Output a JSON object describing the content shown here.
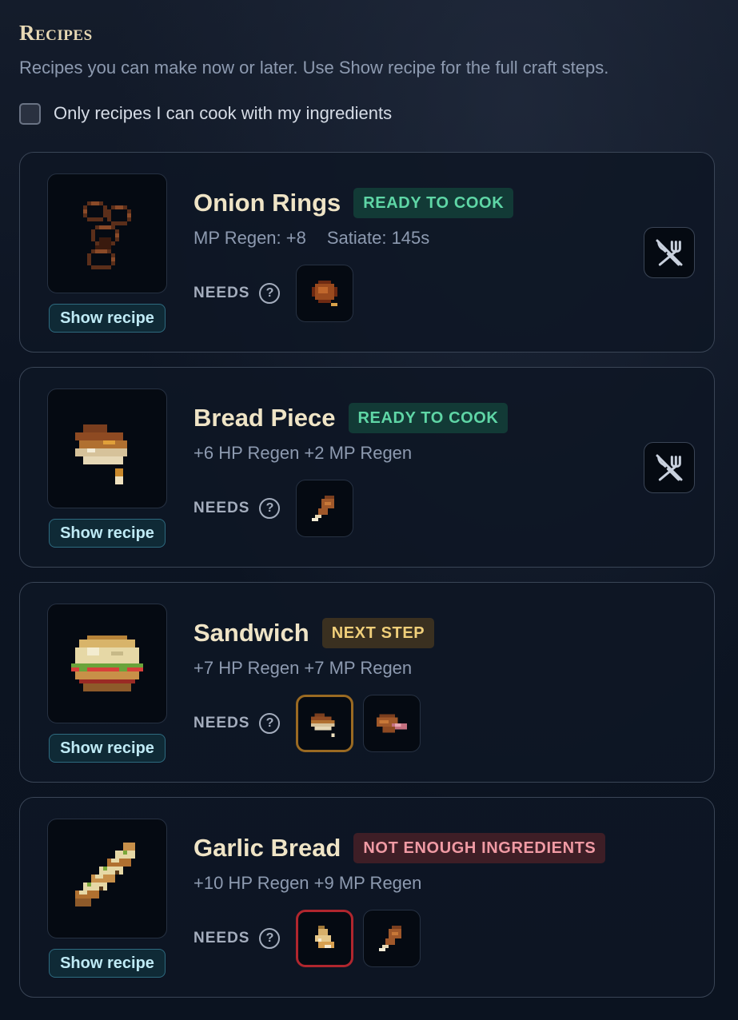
{
  "header": {
    "title": "Recipes",
    "subtitle": "Recipes you can make now or later. Use Show recipe for the full craft steps."
  },
  "filter": {
    "label": "Only recipes I can cook with my ingredients",
    "checked": false
  },
  "labels": {
    "show_recipe": "Show recipe",
    "needs": "NEEDS",
    "help": "?"
  },
  "recipes": [
    {
      "name": "Onion Rings",
      "status": "READY TO COOK",
      "stats": [
        "MP Regen: +8",
        "Satiate: 145s"
      ],
      "ingredients": [
        {
          "icon": "meat-icon",
          "highlight": "none"
        }
      ],
      "cookable": true
    },
    {
      "name": "Bread Piece",
      "status": "READY TO COOK",
      "stats": [
        "+6 HP Regen +2 MP Regen"
      ],
      "ingredients": [
        {
          "icon": "drumstick-icon",
          "highlight": "none"
        }
      ],
      "cookable": true
    },
    {
      "name": "Sandwich",
      "status": "NEXT STEP",
      "stats": [
        "+7 HP Regen +7 MP Regen"
      ],
      "ingredients": [
        {
          "icon": "bread-piece-icon",
          "highlight": "gold"
        },
        {
          "icon": "ham-icon",
          "highlight": "none"
        }
      ],
      "cookable": false
    },
    {
      "name": "Garlic Bread",
      "status": "NOT ENOUGH INGREDIENTS",
      "stats": [
        "+10 HP Regen +9 MP Regen"
      ],
      "ingredients": [
        {
          "icon": "garlic-icon",
          "highlight": "red"
        },
        {
          "icon": "drumstick-icon",
          "highlight": "none"
        }
      ],
      "cookable": false
    }
  ],
  "colors": {
    "ready": "#5fd6a6",
    "next_step": "#f0cf7a",
    "not_enough": "#f09aa4",
    "title": "#efe4c6"
  }
}
